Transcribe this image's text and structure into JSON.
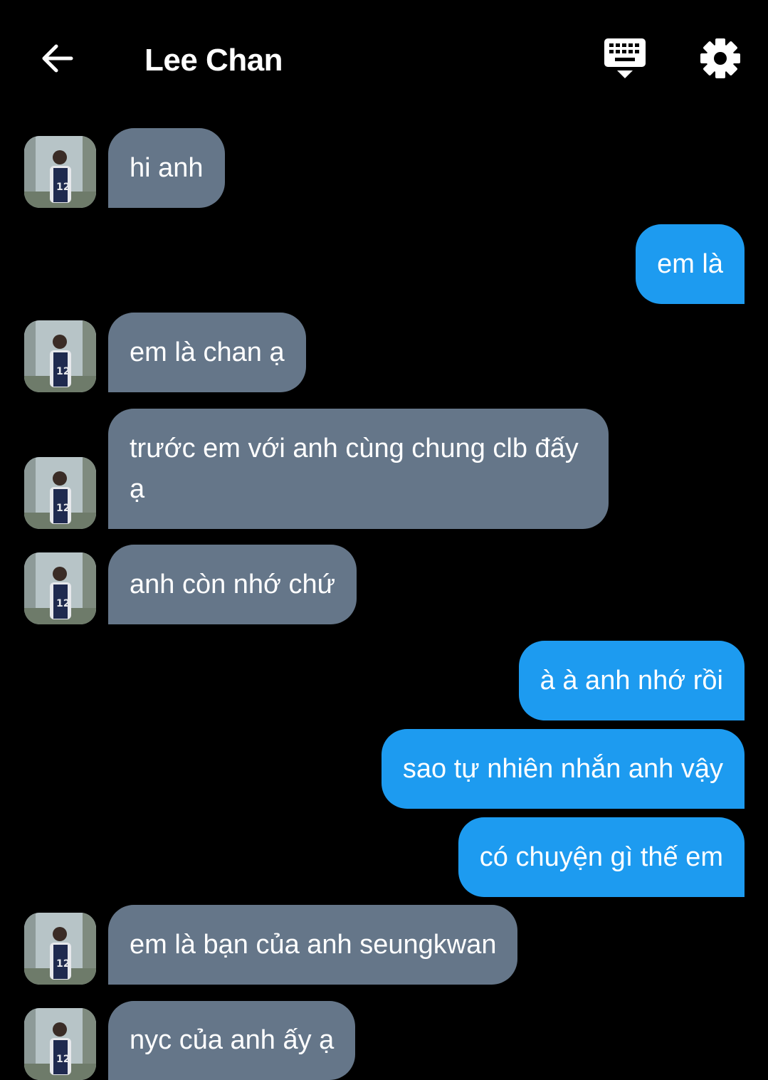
{
  "header": {
    "title": "Lee Chan",
    "back_icon": "arrow-left-icon",
    "keyboard_icon": "keyboard-hide-icon",
    "settings_icon": "gear-icon"
  },
  "colors": {
    "background": "#000000",
    "incoming_bubble": "#657689",
    "outgoing_bubble": "#1d9bf0",
    "text": "#ffffff"
  },
  "messages": [
    {
      "side": "in",
      "text": "hi anh"
    },
    {
      "side": "out",
      "text": "em là"
    },
    {
      "side": "in",
      "text": "em là chan ạ"
    },
    {
      "side": "in",
      "text": "trước em với anh cùng chung clb đấy ạ"
    },
    {
      "side": "in",
      "text": "anh còn nhớ chứ"
    },
    {
      "side": "out",
      "text": "à à anh nhớ rồi"
    },
    {
      "side": "out",
      "text": "sao tự nhiên nhắn anh vậy"
    },
    {
      "side": "out",
      "text": "có chuyện gì thế em"
    },
    {
      "side": "in",
      "text": "em là bạn của anh seungkwan"
    },
    {
      "side": "in",
      "text": "nyc của anh ấy ạ"
    }
  ]
}
